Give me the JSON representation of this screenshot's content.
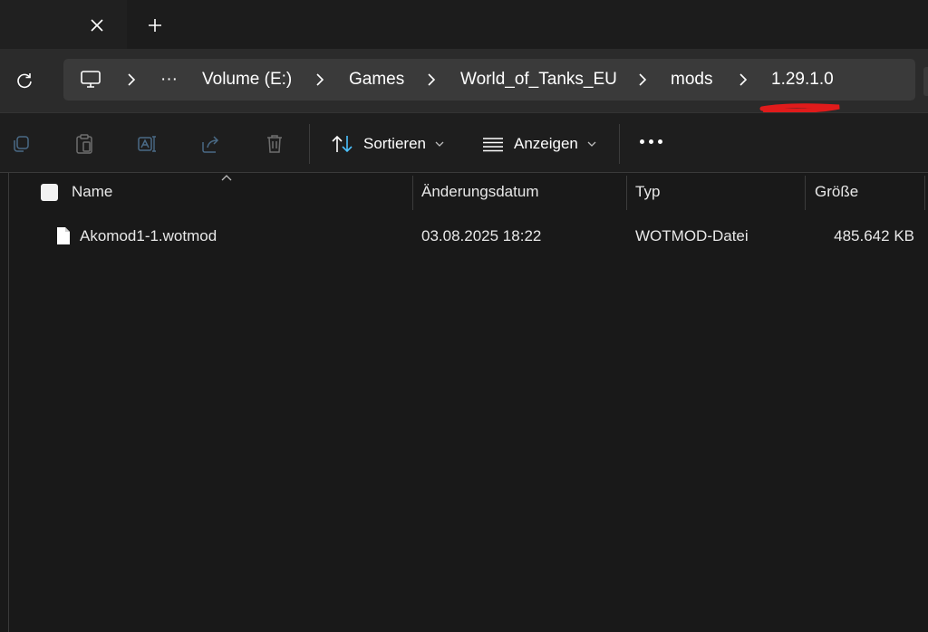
{
  "tabs": {
    "close_icon": "close-icon",
    "new_tab_icon": "plus-icon"
  },
  "address": {
    "refresh_icon": "refresh-icon",
    "root_icon": "computer-icon",
    "overflow_label": "···",
    "crumbs": [
      "Volume (E:)",
      "Games",
      "World_of_Tanks_EU",
      "mods",
      "1.29.1.0"
    ],
    "separator_icon": "chevron-right-icon",
    "highlight_color": "#e01b1b"
  },
  "toolbar": {
    "copy_icon": "copy-icon",
    "paste_icon": "paste-icon",
    "rename_icon": "rename-icon",
    "share_icon": "share-icon",
    "delete_icon": "trash-icon",
    "sort_label": "Sortieren",
    "view_label": "Anzeigen",
    "more_icon": "more-icon",
    "accent_color": "#4cc2ff"
  },
  "list": {
    "headers": {
      "name": "Name",
      "date": "Änderungsdatum",
      "type": "Typ",
      "size": "Größe"
    },
    "files": [
      {
        "name": "Akomod1-1.wotmod",
        "date": "03.08.2025 18:22",
        "type": "WOTMOD-Datei",
        "size": "485.642 KB"
      }
    ]
  }
}
